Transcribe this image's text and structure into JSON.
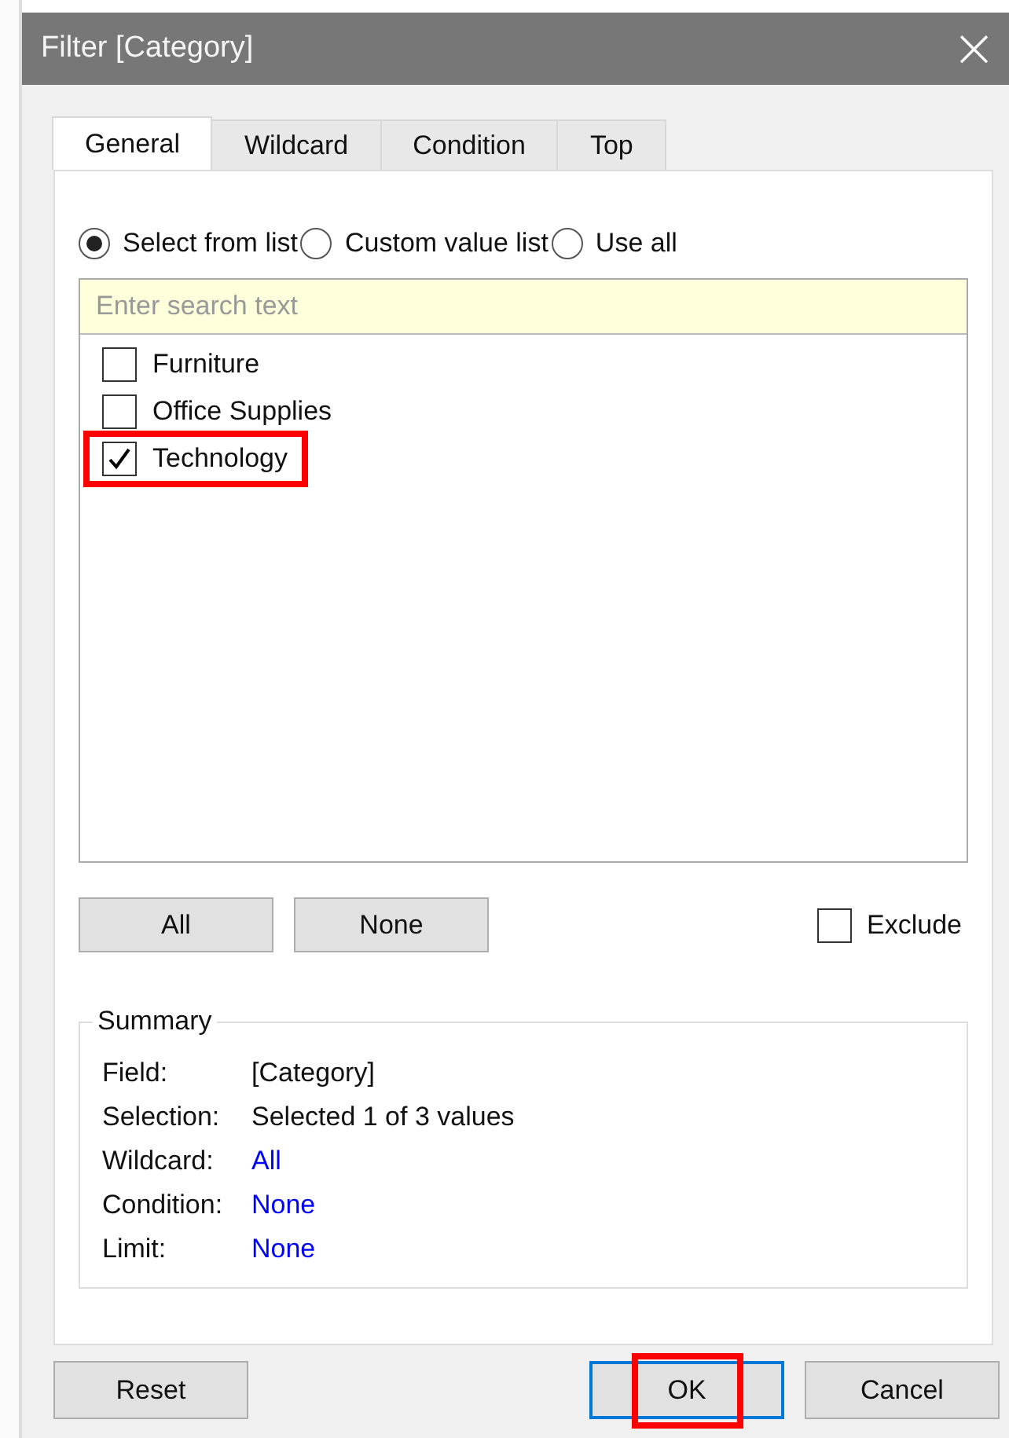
{
  "window": {
    "title": "Filter [Category]",
    "close": "×"
  },
  "tabs": [
    {
      "label": "General",
      "selected": true
    },
    {
      "label": "Wildcard",
      "selected": false
    },
    {
      "label": "Condition",
      "selected": false
    },
    {
      "label": "Top",
      "selected": false
    }
  ],
  "modes": [
    {
      "label": "Select from list",
      "selected": true
    },
    {
      "label": "Custom value list",
      "selected": false
    },
    {
      "label": "Use all",
      "selected": false
    }
  ],
  "search": {
    "placeholder": "Enter search text"
  },
  "items": [
    {
      "label": "Furniture",
      "checked": false,
      "highlighted": false
    },
    {
      "label": "Office Supplies",
      "checked": false,
      "highlighted": false
    },
    {
      "label": "Technology",
      "checked": true,
      "highlighted": true
    }
  ],
  "list_buttons": [
    "All",
    "None"
  ],
  "exclude": {
    "label": "Exclude",
    "checked": false
  },
  "summary": {
    "title": "Summary",
    "rows": [
      {
        "label": "Field:",
        "value": "[Category]",
        "kind": "text"
      },
      {
        "label": "Selection:",
        "value": "Selected 1 of 3 values",
        "kind": "text"
      },
      {
        "label": "Wildcard:",
        "value": "All",
        "kind": "link"
      },
      {
        "label": "Condition:",
        "value": "None",
        "kind": "link"
      },
      {
        "label": "Limit:",
        "value": "None",
        "kind": "link"
      }
    ]
  },
  "buttons": [
    {
      "label": "Reset",
      "default": false,
      "highlighted": false
    },
    {
      "label": "OK",
      "default": true,
      "highlighted": true
    },
    {
      "label": "Cancel",
      "default": false,
      "highlighted": false
    }
  ]
}
